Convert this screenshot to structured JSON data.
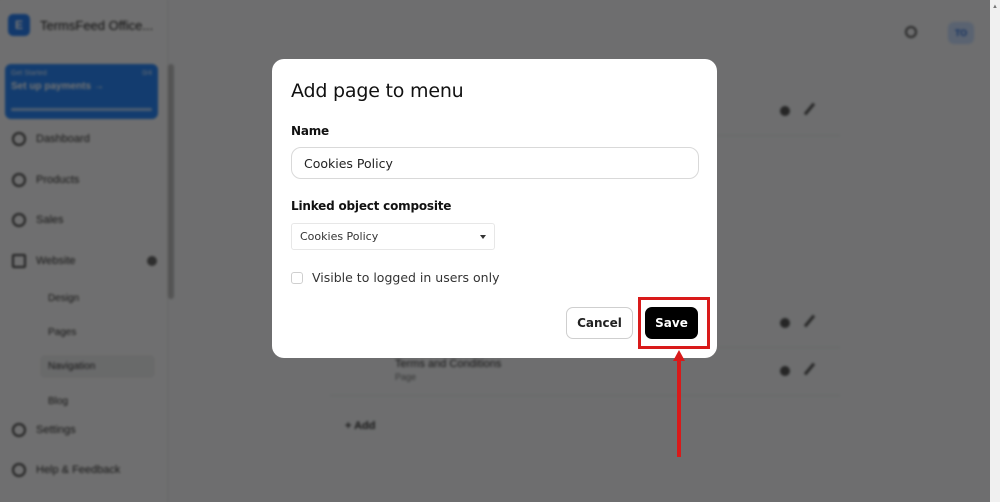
{
  "app": {
    "brand_name": "TermsFeed Office...",
    "brand_logo_letter": "E",
    "promo": {
      "eyebrow": "Get Started",
      "count": "0/4",
      "title": "Set up payments",
      "arrow": "→"
    },
    "sidebar": {
      "items": [
        {
          "label": "Dashboard",
          "icon": "home-icon"
        },
        {
          "label": "Products",
          "icon": "box-icon"
        },
        {
          "label": "Sales",
          "icon": "tag-icon"
        },
        {
          "label": "Website",
          "icon": "monitor-icon"
        },
        {
          "label": "Settings",
          "icon": "gear-icon"
        },
        {
          "label": "Help & Feedback",
          "icon": "help-icon"
        }
      ],
      "website_sub_items": [
        {
          "label": "Design"
        },
        {
          "label": "Pages"
        },
        {
          "label": "Navigation",
          "active": true
        },
        {
          "label": "Blog"
        }
      ]
    },
    "topbar": {
      "avatar_initials": "TO"
    },
    "content": {
      "rows": [
        {
          "title": "",
          "sub": ""
        },
        {
          "title": "Terms and Conditions",
          "sub": "Page"
        }
      ],
      "add_label": "+ Add"
    }
  },
  "modal": {
    "title": "Add page to menu",
    "name_label": "Name",
    "name_value": "Cookies Policy",
    "linked_label": "Linked object composite",
    "linked_selected": "Cookies Policy",
    "visible_label": "Visible to logged in users only",
    "visible_checked": false,
    "cancel_label": "Cancel",
    "save_label": "Save"
  },
  "annotation": {
    "color": "#d91a1a",
    "target": "save-button"
  }
}
